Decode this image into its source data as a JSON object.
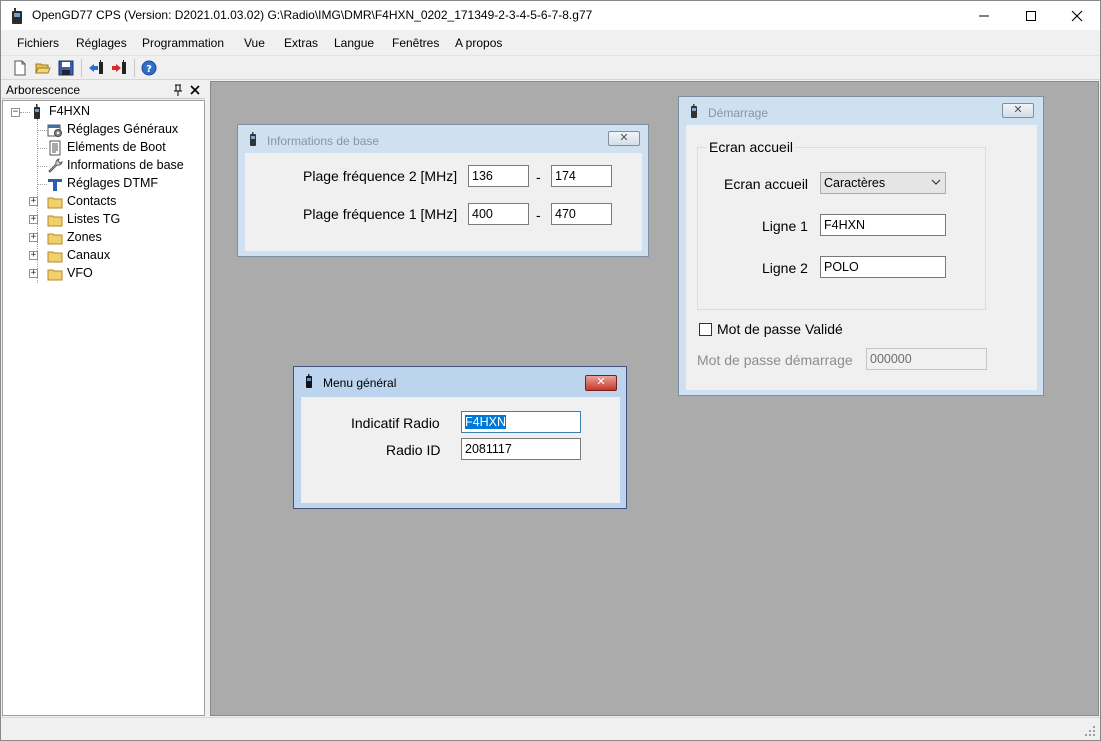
{
  "titlebar": {
    "title": "OpenGD77 CPS (Version:  D2021.01.03.02) G:\\Radio\\IMG\\DMR\\F4HXN_0202_171349-2-3-4-5-6-7-8.g77"
  },
  "menu": [
    {
      "label": "Fichiers"
    },
    {
      "label": "Réglages"
    },
    {
      "label": "Programmation"
    },
    {
      "label": "Vue"
    },
    {
      "label": "Extras"
    },
    {
      "label": "Langue"
    },
    {
      "label": "Fenêtres"
    },
    {
      "label": "A propos"
    }
  ],
  "toolbar": {
    "icons": [
      "new-file-icon",
      "open-folder-icon",
      "save-icon",
      "read-radio-icon",
      "write-radio-icon",
      "help-icon"
    ]
  },
  "tree": {
    "header": "Arborescence",
    "root": "F4HXN",
    "items": [
      {
        "label": "Réglages Généraux",
        "icon": "settings-icon"
      },
      {
        "label": "Eléments de Boot",
        "icon": "document-icon"
      },
      {
        "label": "Informations de base",
        "icon": "wrench-icon"
      },
      {
        "label": "Réglages DTMF",
        "icon": "dtmf-icon"
      },
      {
        "label": "Contacts",
        "icon": "folder-icon"
      },
      {
        "label": "Listes TG",
        "icon": "folder-icon"
      },
      {
        "label": "Zones",
        "icon": "folder-icon"
      },
      {
        "label": "Canaux",
        "icon": "folder-icon"
      },
      {
        "label": "VFO",
        "icon": "folder-icon"
      }
    ]
  },
  "info_window": {
    "title": "Informations de base",
    "close": "✕",
    "freq2_label": "Plage fréquence 2 [MHz]",
    "freq2_min": "136",
    "freq2_max": "174",
    "freq1_label": "Plage fréquence 1 [MHz]",
    "freq1_min": "400",
    "freq1_max": "470",
    "dash": "-"
  },
  "menu_window": {
    "title": "Menu général",
    "close": "✕",
    "callsign_label": "Indicatif Radio",
    "callsign_value": "F4HXN",
    "radio_id_label": "Radio ID",
    "radio_id_value": "2081117"
  },
  "boot_window": {
    "title": "Démarrage",
    "close": "✕",
    "group_title": "Ecran accueil",
    "screen_label": "Ecran accueil",
    "screen_value": "Caractères",
    "line1_label": "Ligne 1",
    "line1_value": "F4HXN",
    "line2_label": "Ligne 2",
    "line2_value": "POLO",
    "password_check_label": "Mot de passe Validé",
    "password_checked": false,
    "password_label": "Mot de passe démarrage",
    "password_value": "000000"
  }
}
